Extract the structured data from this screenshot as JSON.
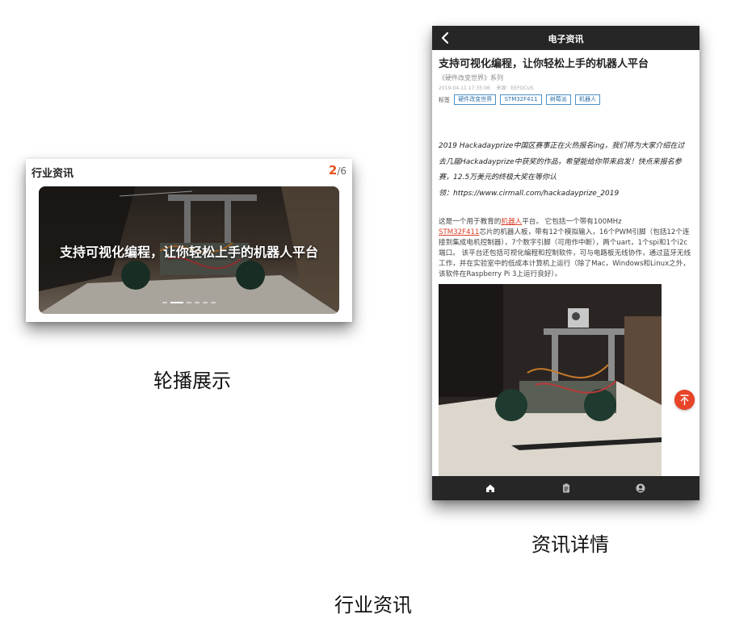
{
  "carousel": {
    "title": "行业资讯",
    "current": "2",
    "total": "/6",
    "caption": "支持可视化编程，让你轻松上手的机器人平台",
    "image_icon": "robot-photo"
  },
  "captions": {
    "carousel_label": "轮播展示",
    "detail_label": "资讯详情",
    "main_label": "行业资讯"
  },
  "phone": {
    "topbar_title": "电子资讯",
    "article": {
      "title": "支持可视化编程，让你轻松上手的机器人平台",
      "series": "《硬件改变世界》系列",
      "date": "2019-04-11 17:35:06",
      "source": "来源：EEFOCUS",
      "tag_label": "标签",
      "tags": [
        "硬件改变世界",
        "STM32F411",
        "树莓派",
        "机器人"
      ],
      "intro": [
        "2019 Hackadayprize中国区赛事正在火热报名ing，我们将为大家介绍在过",
        "去几届Hackadayprize中获奖的作品，希望能给你带来启发！快点来报名参",
        "赛，12.5万美元的终极大奖在等你认",
        "领：https://www.cirmall.com/hackadayprize_2019"
      ],
      "body": {
        "p1": "这是一个用于教育的",
        "link1": "机器人",
        "p2": "平台。 它包括一个带有100MHz",
        "link2": "STM32F411",
        "p3": "芯片的机器人板，带有12个模拟输入，16个PWM引脚（包括12个连接到集成电机控制器），7个数字引脚（可用作中断），两个uart，1个spi和1个i2c端口。 该平台还包括可视化编程和控制软件，可与电路板无线协作，通过蓝牙无线工作，并在实验室中的低成本计算机上运行（除了Mac，Windows和Linux之外，该软件在Raspberry Pi 3上运行良好）。"
      }
    },
    "nav": [
      "home-icon",
      "clipboard-icon",
      "user-icon"
    ],
    "fab_icon": "back-to-top-icon"
  },
  "colors": {
    "accent": "#e8521f",
    "bar": "#262626",
    "link": "#d9402a",
    "tag": "#4a90c8"
  }
}
